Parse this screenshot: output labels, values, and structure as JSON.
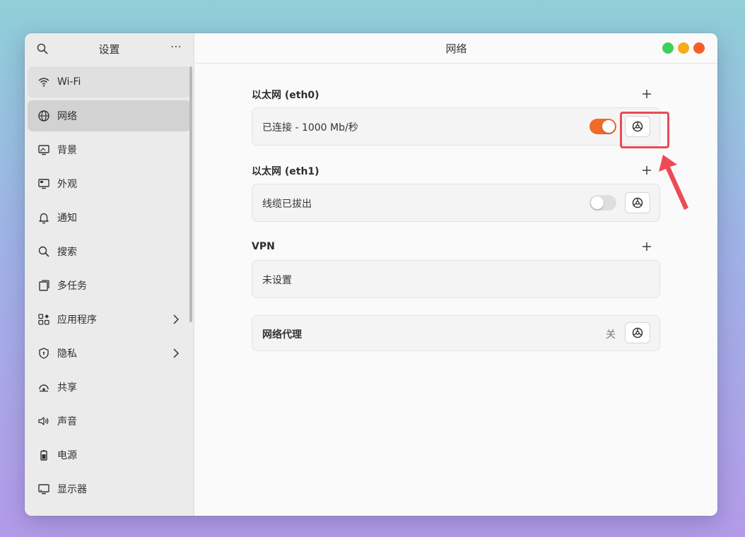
{
  "sidebar": {
    "title": "设置",
    "items": [
      {
        "label": "Wi-Fi",
        "icon": "wifi-icon"
      },
      {
        "label": "网络",
        "icon": "globe-icon"
      },
      {
        "label": "背景",
        "icon": "wallpaper-icon"
      },
      {
        "label": "外观",
        "icon": "appearance-icon"
      },
      {
        "label": "通知",
        "icon": "bell-icon"
      },
      {
        "label": "搜索",
        "icon": "search-icon"
      },
      {
        "label": "多任务",
        "icon": "multitask-icon"
      },
      {
        "label": "应用程序",
        "icon": "apps-icon"
      },
      {
        "label": "隐私",
        "icon": "shield-icon"
      },
      {
        "label": "共享",
        "icon": "share-icon"
      },
      {
        "label": "声音",
        "icon": "speaker-icon"
      },
      {
        "label": "电源",
        "icon": "battery-icon"
      },
      {
        "label": "显示器",
        "icon": "display-icon"
      }
    ]
  },
  "main": {
    "title": "网络",
    "eth0": {
      "title": "以太网 (eth0)",
      "status": "已连接 - 1000 Mb/秒",
      "enabled": true
    },
    "eth1": {
      "title": "以太网 (eth1)",
      "status": "线缆已拔出",
      "enabled": false
    },
    "vpn": {
      "title": "VPN",
      "status": "未设置"
    },
    "proxy": {
      "title": "网络代理",
      "status": "关"
    }
  },
  "colors": {
    "accent": "#f06a2a",
    "highlight": "#e84a56",
    "close": "#f5602a",
    "minimize": "#f7ac1c",
    "maximize": "#3dd15c"
  }
}
